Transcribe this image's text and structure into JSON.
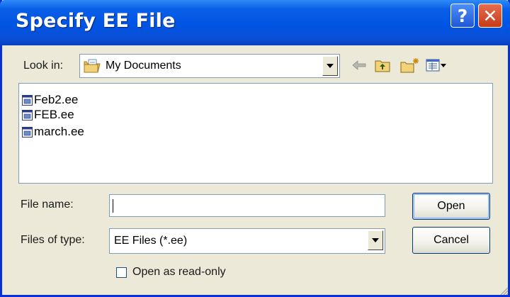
{
  "window": {
    "title": "Specify EE File",
    "help_glyph": "?",
    "close_glyph": "✕"
  },
  "lookin": {
    "label": "Look in:",
    "value": "My Documents",
    "icon": "my-documents-folder-icon"
  },
  "toolbar": {
    "icons": [
      "back-arrow-icon",
      "up-one-level-icon",
      "create-new-folder-icon",
      "view-menu-icon"
    ]
  },
  "files": [
    {
      "name": "Feb2.ee",
      "icon": "ee-file-icon"
    },
    {
      "name": "FEB.ee",
      "icon": "ee-file-icon"
    },
    {
      "name": "march.ee",
      "icon": "ee-file-icon"
    }
  ],
  "filename": {
    "label": "File name:",
    "value": ""
  },
  "filetype": {
    "label": "Files of type:",
    "value": "EE Files (*.ee)"
  },
  "buttons": {
    "open": "Open",
    "cancel": "Cancel"
  },
  "readonly": {
    "label": "Open as read-only",
    "checked": false
  },
  "colors": {
    "titlebar": "#0054e3",
    "dialog_bg": "#ece9d8",
    "close_button": "#c43c18",
    "help_button": "#2058d8",
    "field_border": "#7f9db9"
  }
}
